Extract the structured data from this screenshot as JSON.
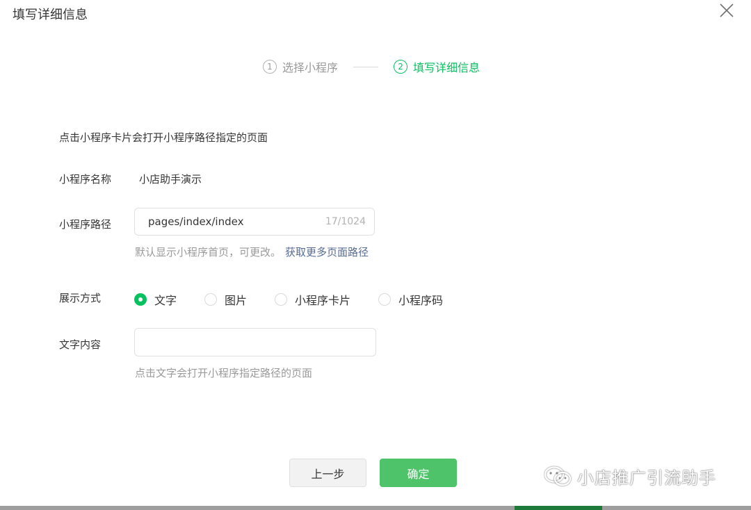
{
  "dialog": {
    "title": "填写详细信息"
  },
  "steps": [
    {
      "num": "1",
      "label": "选择小程序"
    },
    {
      "num": "2",
      "label": "填写详细信息"
    }
  ],
  "form": {
    "intro": "点击小程序卡片会打开小程序路径指定的页面",
    "name_label": "小程序名称",
    "name_value": "小店助手演示",
    "path_label": "小程序路径",
    "path_value": "pages/index/index",
    "path_count": "17/1024",
    "path_help": "默认显示小程序首页，可更改。",
    "path_link": "获取更多页面路径",
    "display_label": "展示方式",
    "display_options": [
      "文字",
      "图片",
      "小程序卡片",
      "小程序码"
    ],
    "display_selected": "文字",
    "text_label": "文字内容",
    "text_value": "",
    "text_help": "点击文字会打开小程序指定路径的页面"
  },
  "buttons": {
    "prev": "上一步",
    "confirm": "确定"
  },
  "watermark": {
    "text": "小店推广引流助手",
    "icon": "wechat-icon"
  },
  "colors": {
    "accent": "#07c160",
    "confirm_button": "#4fc36a",
    "link": "#576b95"
  }
}
